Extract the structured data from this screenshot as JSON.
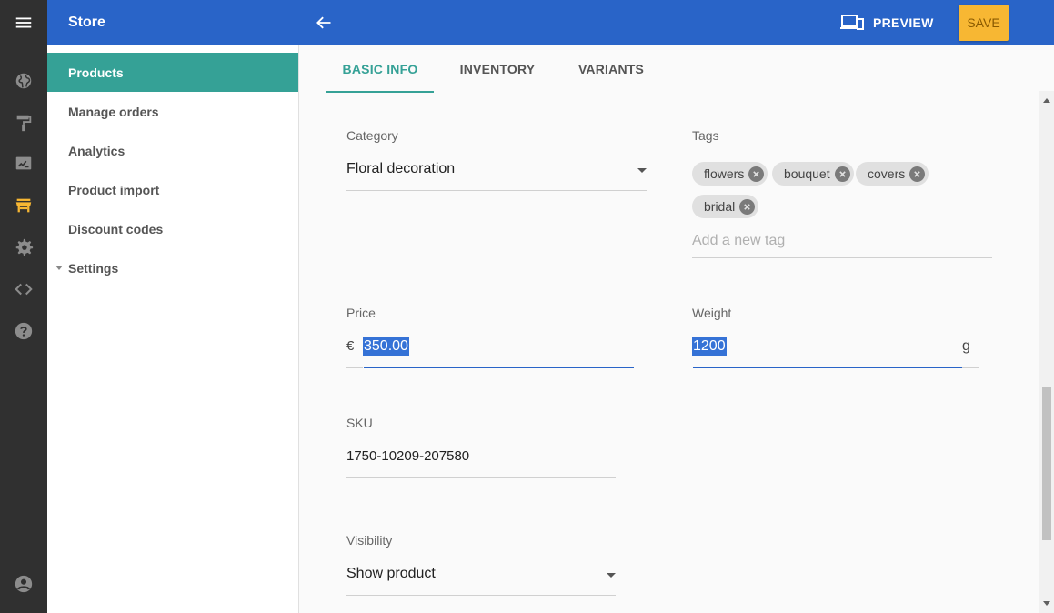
{
  "app": {
    "title": "Store"
  },
  "colors": {
    "topbar": "#2964c8",
    "accent": "#35a196",
    "save": "#f7b733",
    "rail": "#303030",
    "rail_active_icon": "#f7b733"
  },
  "rail": {
    "icons": [
      "menu-icon",
      "globe-icon",
      "paint-roller-icon",
      "signature-icon",
      "store-icon",
      "gear-icon",
      "code-icon",
      "help-icon",
      "account-icon"
    ]
  },
  "header": {
    "preview_label": "PREVIEW",
    "save_label": "SAVE"
  },
  "sidebar": {
    "items": [
      {
        "label": "Products",
        "active": true
      },
      {
        "label": "Manage orders"
      },
      {
        "label": "Analytics"
      },
      {
        "label": "Product import"
      },
      {
        "label": "Discount codes"
      },
      {
        "label": "Settings",
        "expandable": true
      }
    ]
  },
  "tabs": [
    {
      "label": "BASIC INFO",
      "active": true
    },
    {
      "label": "INVENTORY"
    },
    {
      "label": "VARIANTS"
    }
  ],
  "form": {
    "category": {
      "label": "Category",
      "value": "Floral decoration"
    },
    "tags": {
      "label": "Tags",
      "chips": [
        "flowers",
        "bouquet",
        "covers",
        "bridal"
      ],
      "placeholder": "Add a new tag"
    },
    "price": {
      "label": "Price",
      "currency": "€",
      "value": "350.00"
    },
    "weight": {
      "label": "Weight",
      "value": "1200",
      "unit": "g"
    },
    "sku": {
      "label": "SKU",
      "value": "1750-10209-207580"
    },
    "visibility": {
      "label": "Visibility",
      "value": "Show product"
    }
  }
}
